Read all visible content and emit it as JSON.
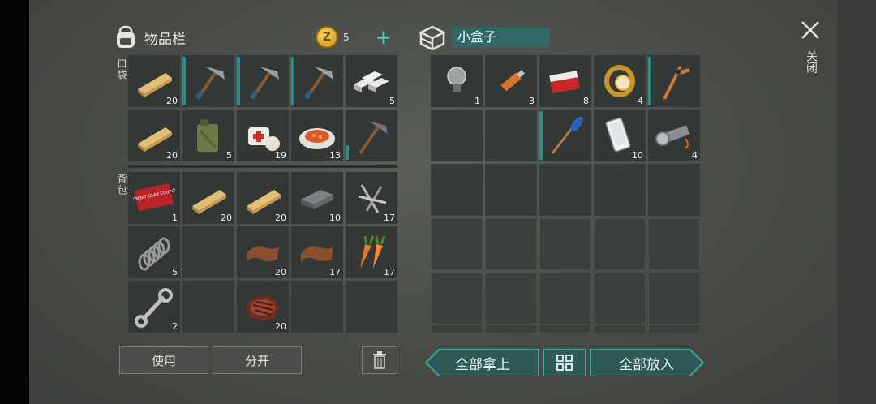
{
  "inventory": {
    "title": "物品栏",
    "coins": "5",
    "coin_symbol": "Z",
    "add_symbol": "+",
    "pocket_label": "口袋",
    "backpack_label": "背包",
    "pocket_items": [
      {
        "icon": "wood-plank-icon",
        "count": "20"
      },
      {
        "icon": "pickaxe-icon",
        "count": ""
      },
      {
        "icon": "pickaxe-icon",
        "count": ""
      },
      {
        "icon": "pickaxe-icon",
        "count": ""
      },
      {
        "icon": "iron-ingot-icon",
        "count": "5"
      },
      {
        "icon": "wood-plank-icon",
        "count": "20"
      },
      {
        "icon": "jerry-can-icon",
        "count": "5"
      },
      {
        "icon": "bandage-icon",
        "count": "19"
      },
      {
        "icon": "food-plate-icon",
        "count": "13"
      },
      {
        "icon": "pickaxe-icon",
        "count": ""
      }
    ],
    "backpack_items": [
      {
        "icon": "coupon-icon",
        "count": "1",
        "text": "COMBAT GEAR COUPON"
      },
      {
        "icon": "wood-plank-icon",
        "count": "20"
      },
      {
        "icon": "wood-plank-icon",
        "count": "20"
      },
      {
        "icon": "iron-bar-icon",
        "count": "10"
      },
      {
        "icon": "nails-icon",
        "count": "17"
      },
      {
        "icon": "spring-icon",
        "count": "5"
      },
      {
        "icon": "empty",
        "count": ""
      },
      {
        "icon": "leather-icon",
        "count": "20"
      },
      {
        "icon": "leather-icon",
        "count": "17"
      },
      {
        "icon": "carrot-icon",
        "count": "17"
      },
      {
        "icon": "wrench-icon",
        "count": "2"
      },
      {
        "icon": "empty",
        "count": ""
      },
      {
        "icon": "steak-icon",
        "count": "20"
      },
      {
        "icon": "empty",
        "count": ""
      },
      {
        "icon": "empty",
        "count": ""
      }
    ],
    "use_label": "使用",
    "split_label": "分开"
  },
  "box": {
    "title": "小盒子",
    "items": [
      {
        "icon": "light-bulb-icon",
        "count": "1"
      },
      {
        "icon": "usb-stick-icon",
        "count": "3"
      },
      {
        "icon": "cigarettes-icon",
        "count": "8"
      },
      {
        "icon": "gold-watch-icon",
        "count": "4"
      },
      {
        "icon": "hockey-stick-icon",
        "count": ""
      },
      {
        "icon": "empty",
        "count": ""
      },
      {
        "icon": "empty",
        "count": ""
      },
      {
        "icon": "paddle-icon",
        "count": ""
      },
      {
        "icon": "smartphone-icon",
        "count": "10"
      },
      {
        "icon": "flashlight-icon",
        "count": "4"
      }
    ],
    "take_all_label": "全部拿上",
    "put_all_label": "全部放入"
  },
  "window": {
    "close_label": "关闭"
  },
  "colors": {
    "accent": "#2f8f87",
    "accent_light": "#3fd1bd"
  }
}
